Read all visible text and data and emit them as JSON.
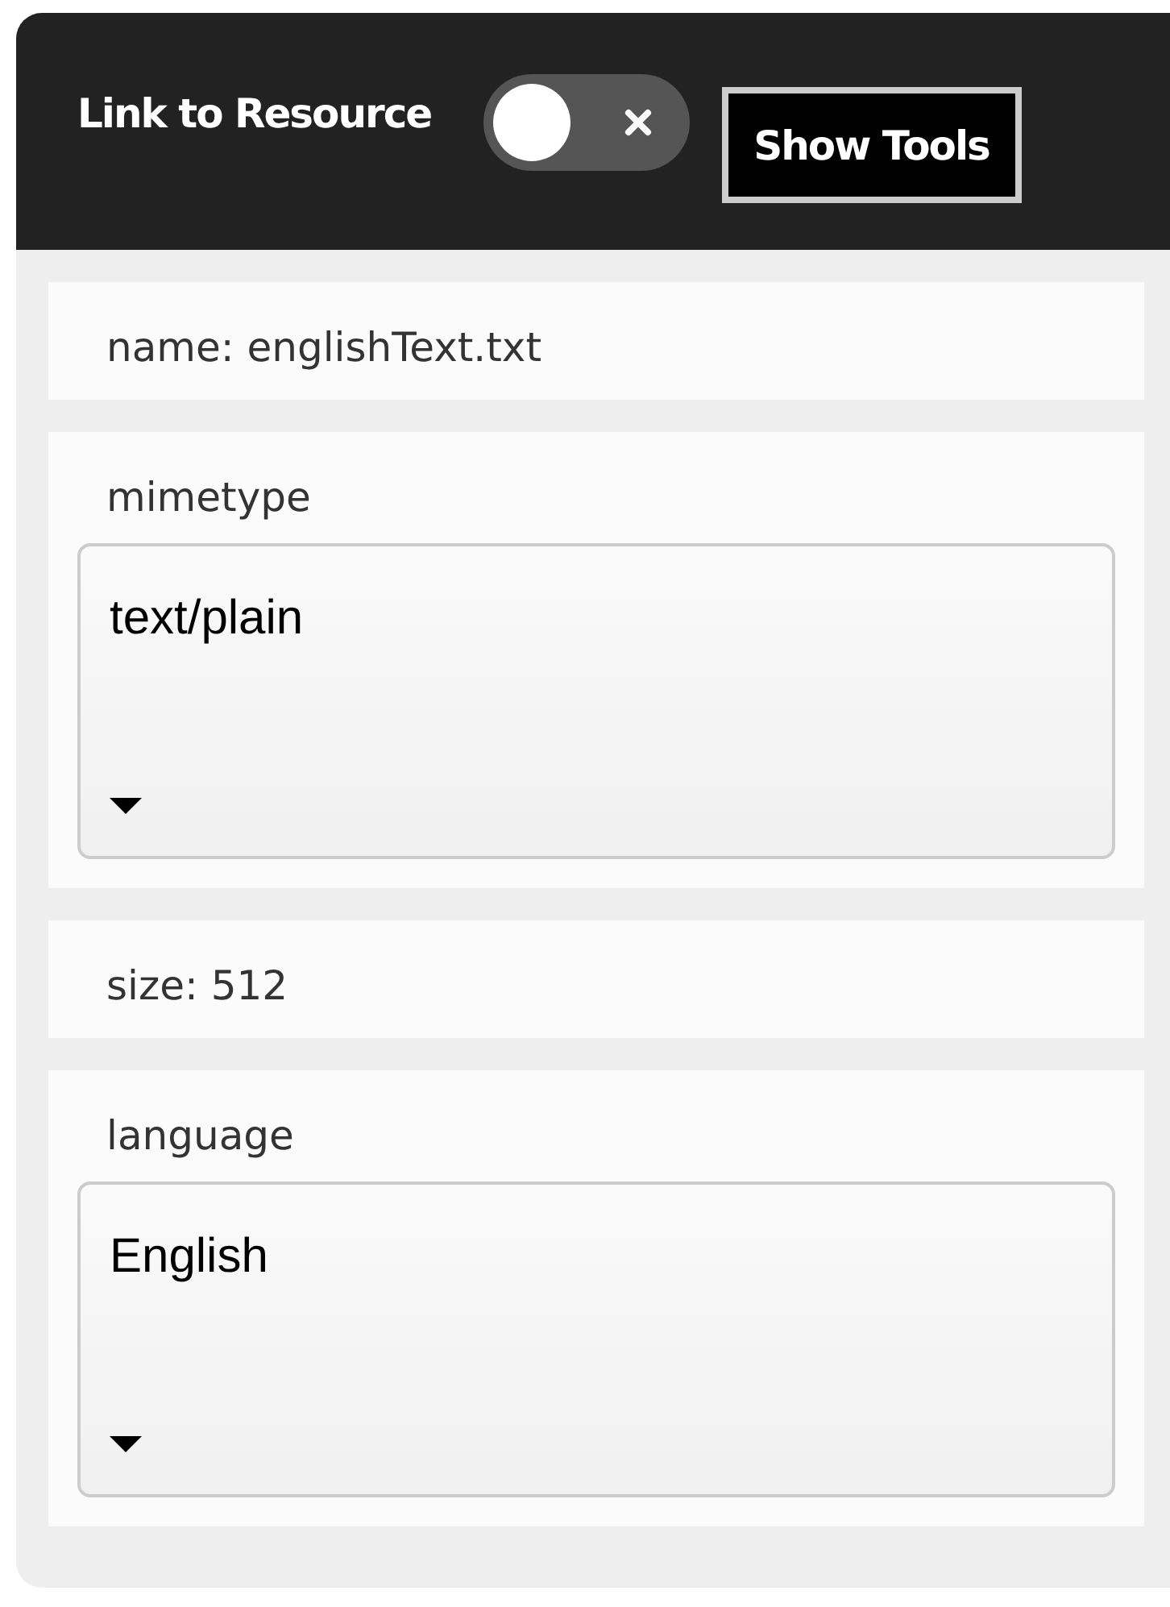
{
  "header": {
    "title": "Link to Resource",
    "toggle": {
      "on": false
    },
    "button": "Show Tools"
  },
  "fields": [
    {
      "kind": "text",
      "text": "name: englishText.txt"
    },
    {
      "kind": "select",
      "label": "mimetype",
      "value": "text/plain"
    },
    {
      "kind": "text",
      "text": "size: 512"
    },
    {
      "kind": "select",
      "label": "language",
      "value": "English"
    }
  ]
}
